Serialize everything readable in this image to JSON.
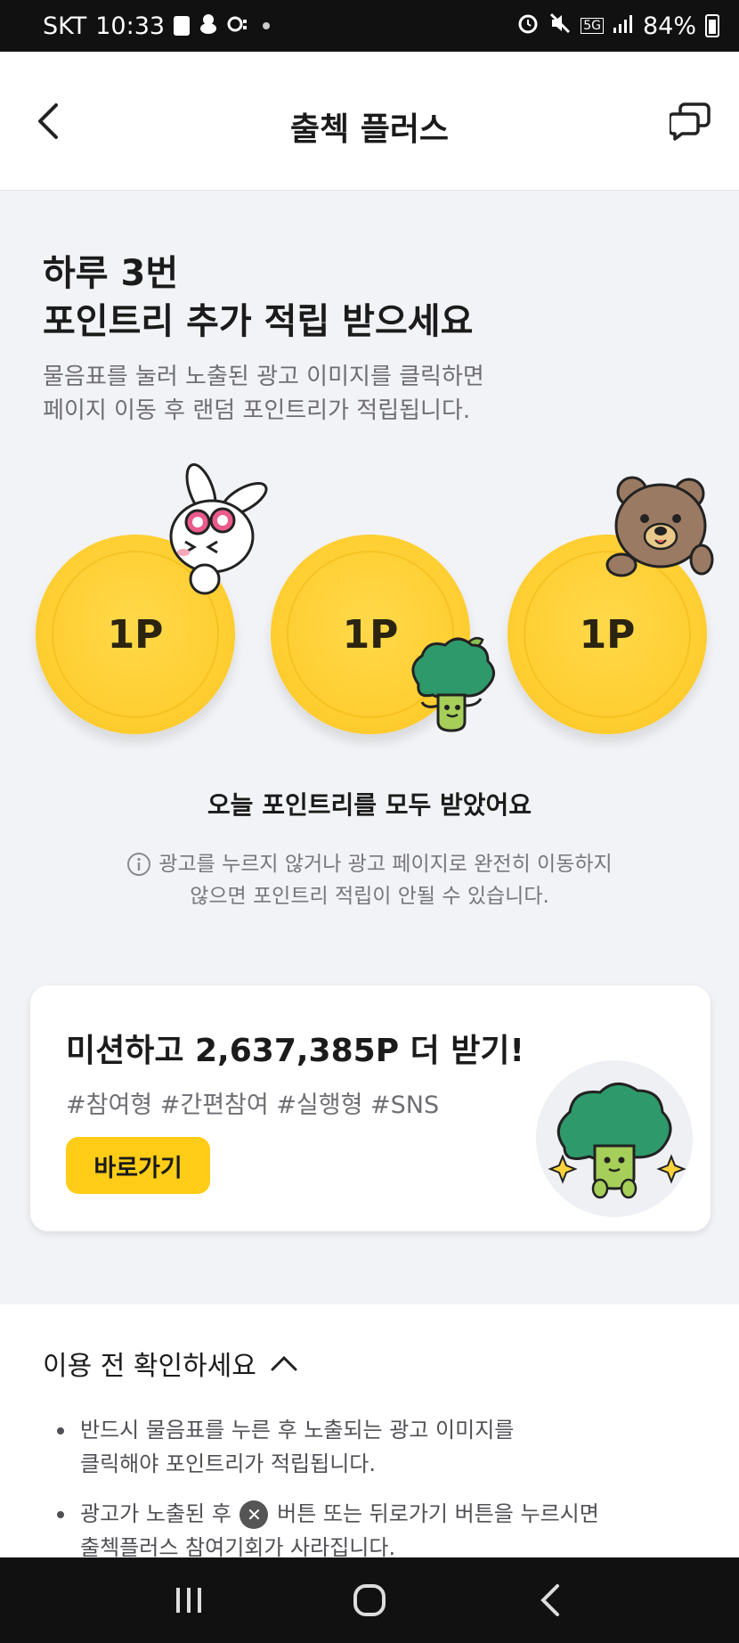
{
  "status_bar": {
    "carrier": "SKT",
    "time": "10:33",
    "network": "5G",
    "battery": "84%"
  },
  "header": {
    "title": "출첵 플러스"
  },
  "hero": {
    "title_line1": "하루 3번",
    "title_line2": "포인트리 추가 적립 받으세요",
    "desc_line1": "물음표를 눌러 노출된 광고 이미지를 클릭하면",
    "desc_line2": "페이지 이동 후 랜덤 포인트리가 적립됩니다."
  },
  "coins": [
    {
      "label": "1P"
    },
    {
      "label": "1P"
    },
    {
      "label": "1P"
    }
  ],
  "done_message": "오늘 포인트리를 모두 받았어요",
  "notice": {
    "line1": "광고를 누르지 않거나 광고 페이지로 완전히 이동하지",
    "line2": "않으면 포인트리 적립이 안될 수 있습니다."
  },
  "mission": {
    "title": "미션하고 2,637,385P 더 받기!",
    "tags": "#참여형 #간편참여 #실행형 #SNS",
    "button": "바로가기"
  },
  "info": {
    "heading": "이용 전 확인하세요",
    "item1_line1": "반드시 물음표를 누른 후 노출되는 광고 이미지를",
    "item1_line2": "클릭해야 포인트리가 적립됩니다.",
    "item2_before": "광고가 노출된 후",
    "item2_after": "버튼 또는 뒤로가기 버튼을 누르시면",
    "item2_line2": "출첵플러스 참여기회가 사라집니다."
  },
  "colors": {
    "accent": "#ffcd17",
    "coin": "#ffd43b",
    "broccoli": "#2e9a6b"
  }
}
